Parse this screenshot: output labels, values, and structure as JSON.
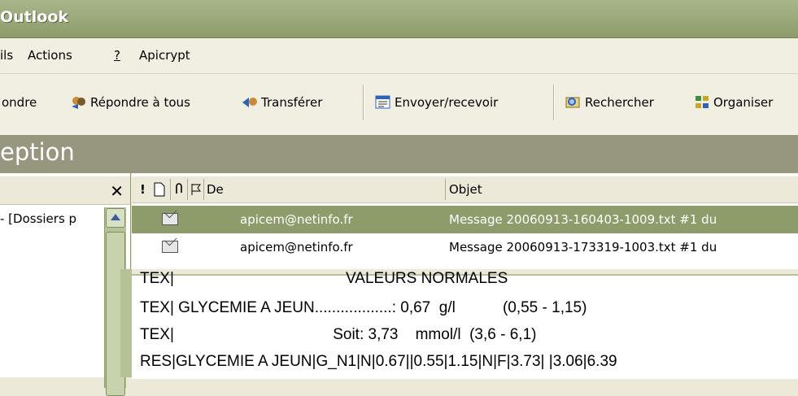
{
  "window": {
    "title": "Outlook"
  },
  "menu": {
    "items": [
      "ils",
      "Actions ",
      "?",
      "Apicrypt"
    ]
  },
  "toolbar": {
    "reply": "ondre",
    "reply_all": "Répondre à tous",
    "forward": "Transférer",
    "send_receive": "Envoyer/recevoir",
    "search": "Rechercher",
    "organize": "Organiser"
  },
  "banner": {
    "title": "eption"
  },
  "folder_pane": {
    "item": "- [Dossiers p",
    "close": "✕"
  },
  "message_list": {
    "columns": {
      "from": "De",
      "subject": "Objet"
    },
    "rows": [
      {
        "from": "apicem@netinfo.fr",
        "subject": "Message 20060913-160403-1009.txt #1 du"
      },
      {
        "from": "apicem@netinfo.fr",
        "subject": "Message 20060913-173319-1003.txt #1 du"
      }
    ]
  },
  "preview": {
    "lines": [
      "TEX|                                        VALEURS NORMALES",
      "TEX| GLYCEMIE A JEUN..................: 0,67  g/l           (0,55 - 1,15)",
      "TEX|                                     Soit: 3,73    mmol/l  (3,6 - 6,1)",
      "RES|GLYCEMIE A JEUN|G_N1|N|0.67||0.55|1.15|N|F|3.73| |3.06|6.39"
    ]
  }
}
